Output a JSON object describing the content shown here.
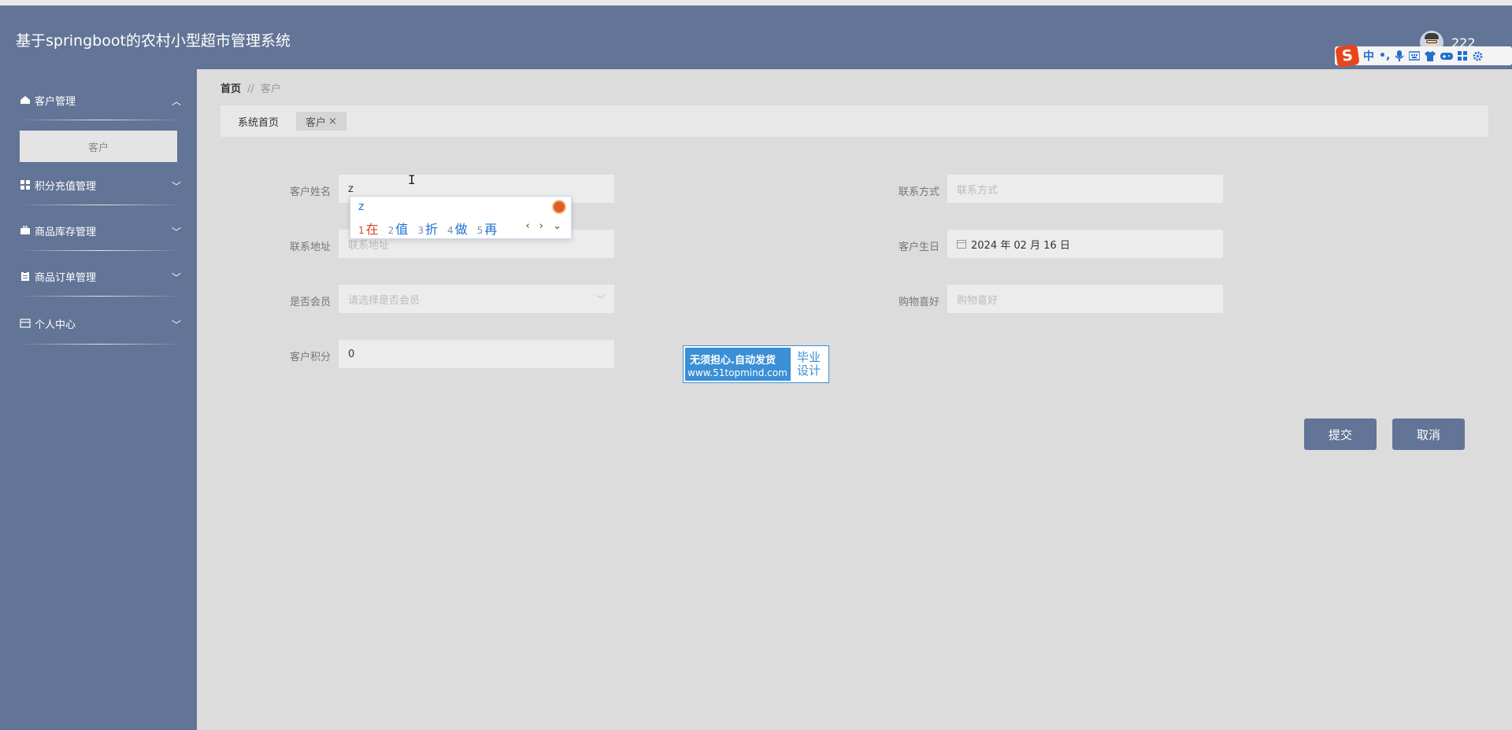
{
  "header": {
    "title": "基于springboot的农村小型超市管理系统",
    "username": "222"
  },
  "ime_toolbar": {
    "logo": "S",
    "mode": "中",
    "punct": "•,"
  },
  "sidebar": {
    "items": [
      {
        "label": "客户管理",
        "icon": "home-icon",
        "expanded": true
      },
      {
        "label": "积分充值管理",
        "icon": "grid-icon",
        "expanded": false
      },
      {
        "label": "商品库存管理",
        "icon": "briefcase-icon",
        "expanded": false
      },
      {
        "label": "商品订单管理",
        "icon": "clipboard-icon",
        "expanded": false
      },
      {
        "label": "个人中心",
        "icon": "card-icon",
        "expanded": false
      }
    ],
    "subitem": "客户"
  },
  "breadcrumb": {
    "home": "首页",
    "sep": "//",
    "current": "客户"
  },
  "tabs": [
    {
      "label": "系统首页"
    },
    {
      "label": "客户",
      "close": "×"
    }
  ],
  "form": {
    "name_label": "客户姓名",
    "name_value": "z",
    "phone_label": "联系方式",
    "phone_placeholder": "联系方式",
    "address_label": "联系地址",
    "address_placeholder": "联系地址",
    "birthday_label": "客户生日",
    "birthday_value": "2024 年 02 月 16 日",
    "member_label": "是否会员",
    "member_placeholder": "请选择是否会员",
    "hobby_label": "购物喜好",
    "hobby_placeholder": "购物喜好",
    "points_label": "客户积分",
    "points_value": "0",
    "submit": "提交",
    "cancel": "取消"
  },
  "ime_popup": {
    "composition": "z",
    "candidates": [
      {
        "n": "1",
        "text": "在"
      },
      {
        "n": "2",
        "text": "值"
      },
      {
        "n": "3",
        "text": "折"
      },
      {
        "n": "4",
        "text": "做"
      },
      {
        "n": "5",
        "text": "再"
      }
    ],
    "nav": "‹ › ⌄"
  },
  "watermark": {
    "line1": "无须担心.自动发货",
    "line2": "www.51topmind.com",
    "right1": "毕业",
    "right2": "设计"
  },
  "colors": {
    "primary": "#637596",
    "ime_blue": "#1f6fd1",
    "ime_red": "#d9432a",
    "watermark_blue": "#3a8fd6"
  }
}
